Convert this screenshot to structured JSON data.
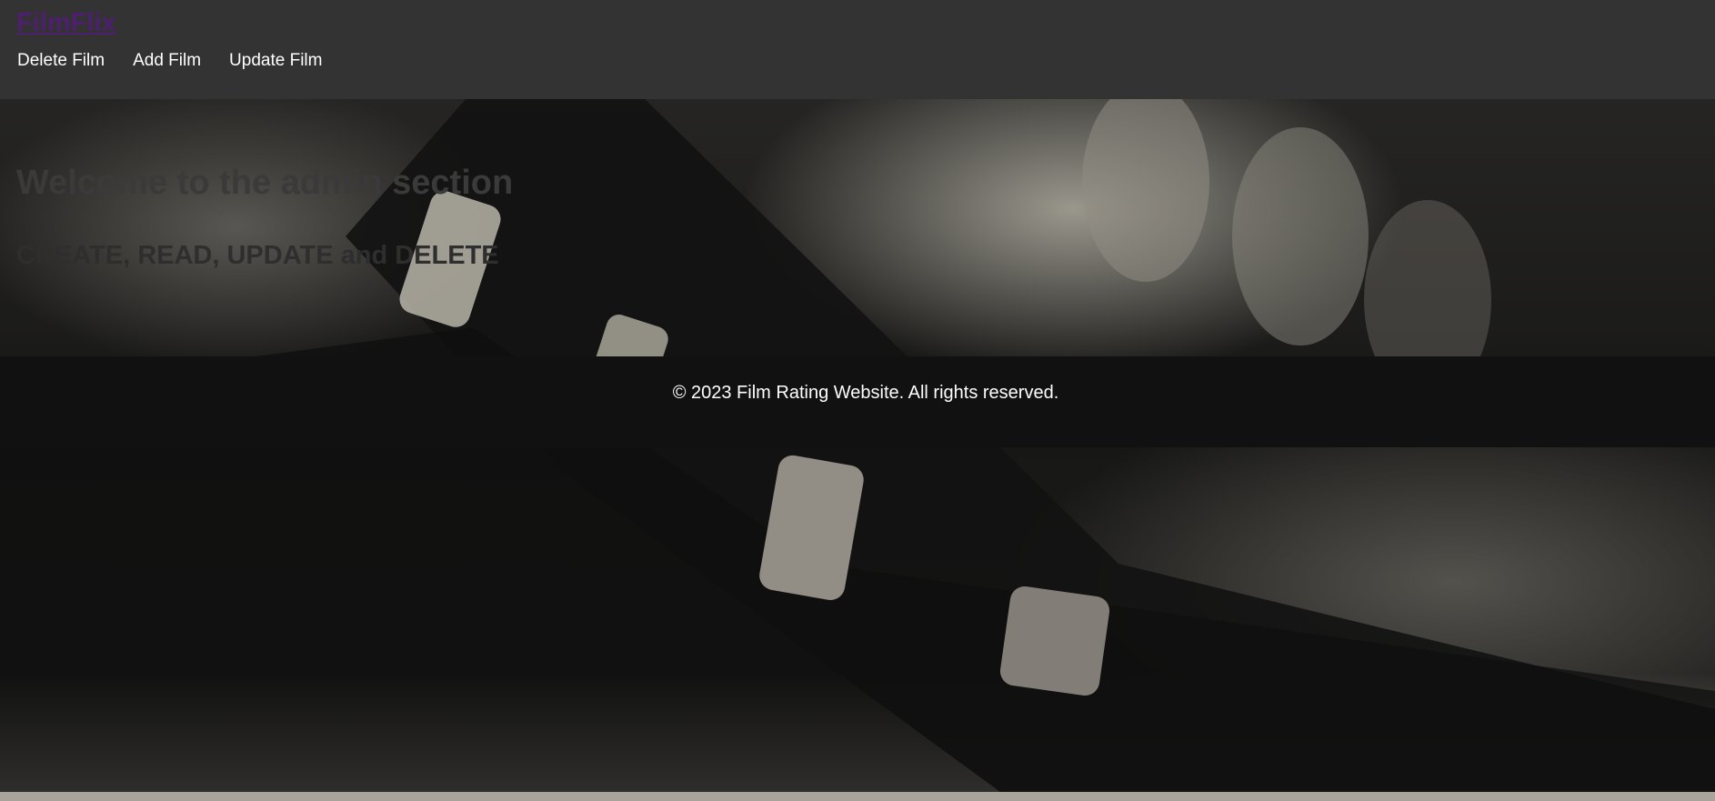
{
  "header": {
    "brand": "FilmFlix",
    "nav": [
      {
        "label": "Delete Film"
      },
      {
        "label": "Add Film"
      },
      {
        "label": "Update Film"
      }
    ]
  },
  "main": {
    "title": "Welcome to the admin section",
    "subtitle": "CREATE, READ, UPDATE and DELETE"
  },
  "footer": {
    "text": "© 2023 Film Rating Website. All rights reserved."
  },
  "colors": {
    "navbar_bg": "#333333",
    "brand": "#4d1f6e",
    "footer_bg": "#111111",
    "nav_text": "#ffffff"
  },
  "icons": {
    "background": "film-strip-photo"
  }
}
